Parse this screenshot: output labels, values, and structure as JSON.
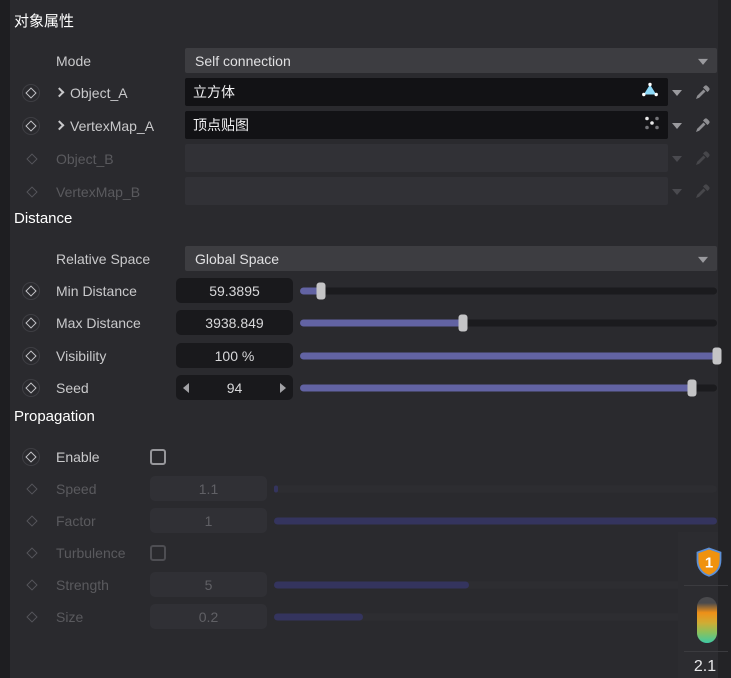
{
  "header": {
    "title": "对象属性"
  },
  "object_section": {
    "mode": {
      "label": "Mode",
      "value": "Self connection"
    },
    "object_a": {
      "label": "Object_A",
      "value": "立方体",
      "icon": "polygon-object-icon"
    },
    "vertexmap_a": {
      "label": "VertexMap_A",
      "value": "顶点贴图",
      "icon": "vertex-map-icon"
    },
    "object_b": {
      "label": "Object_B",
      "value": ""
    },
    "vertexmap_b": {
      "label": "VertexMap_B",
      "value": ""
    }
  },
  "distance": {
    "title": "Distance",
    "relative_space": {
      "label": "Relative Space",
      "value": "Global Space"
    },
    "min_distance": {
      "label": "Min Distance",
      "value": "59.3895",
      "slider_pct": 5
    },
    "max_distance": {
      "label": "Max Distance",
      "value": "3938.849",
      "slider_pct": 39
    },
    "visibility": {
      "label": "Visibility",
      "value": "100 %",
      "slider_pct": 100
    },
    "seed": {
      "label": "Seed",
      "value": "94",
      "slider_pct": 94
    }
  },
  "propagation": {
    "title": "Propagation",
    "enable": {
      "label": "Enable",
      "checked": false
    },
    "speed": {
      "label": "Speed",
      "value": "1.1",
      "slider_pct": 1
    },
    "factor": {
      "label": "Factor",
      "value": "1",
      "slider_pct": 100
    },
    "turbulence": {
      "label": "Turbulence",
      "checked": false
    },
    "strength": {
      "label": "Strength",
      "value": "5",
      "slider_pct": 44
    },
    "size": {
      "label": "Size",
      "value": "0.2",
      "slider_pct": 20
    }
  },
  "overlay": {
    "shield_badge": "1",
    "version_label": "2.1"
  },
  "colors": {
    "accent_slider": "#6263a3",
    "shield_orange": "#f0920e",
    "shield_outline": "#5c8fd6",
    "polygon_icon_cyan": "#8ed9f8"
  }
}
